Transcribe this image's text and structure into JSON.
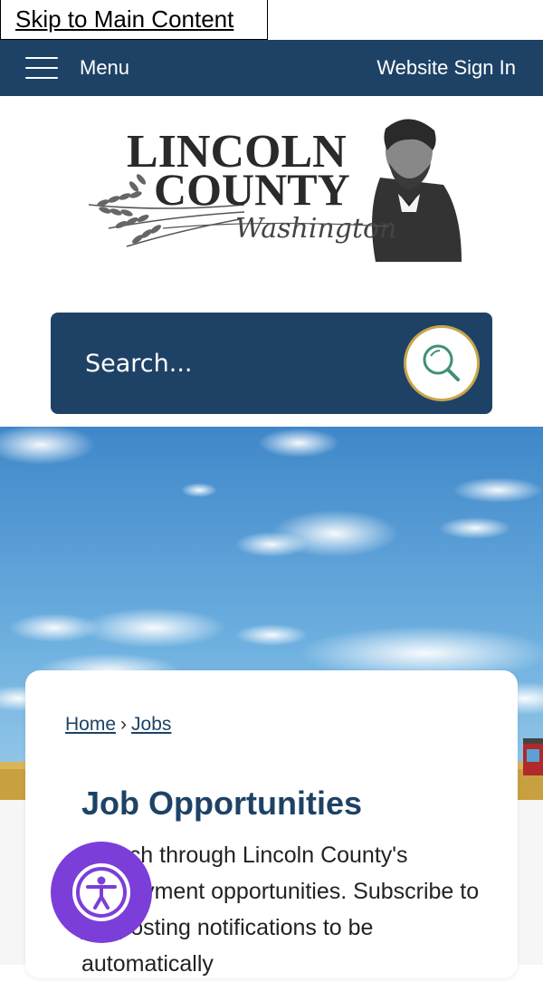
{
  "skip_link": {
    "label": "Skip to Main Content"
  },
  "topbar": {
    "menu_label": "Menu",
    "signin_label": "Website Sign In"
  },
  "logo": {
    "line1": "LINCOLN",
    "line2": "COUNTY",
    "line3": "Washington"
  },
  "search": {
    "placeholder": "Search..."
  },
  "breadcrumb": {
    "home": "Home",
    "separator": "›",
    "current": "Jobs"
  },
  "content": {
    "title": "Job Opportunities",
    "intro": "Search through Lincoln County's employment opportunities. Subscribe to job posting notifications to be automatically"
  },
  "colors": {
    "brand_navy": "#1e4266",
    "search_button_ring": "#c9a54a",
    "accessibility_purple": "#7c3ed8"
  },
  "icons": {
    "menu": "hamburger-icon",
    "search": "magnifier-icon",
    "accessibility": "accessibility-person-icon"
  }
}
